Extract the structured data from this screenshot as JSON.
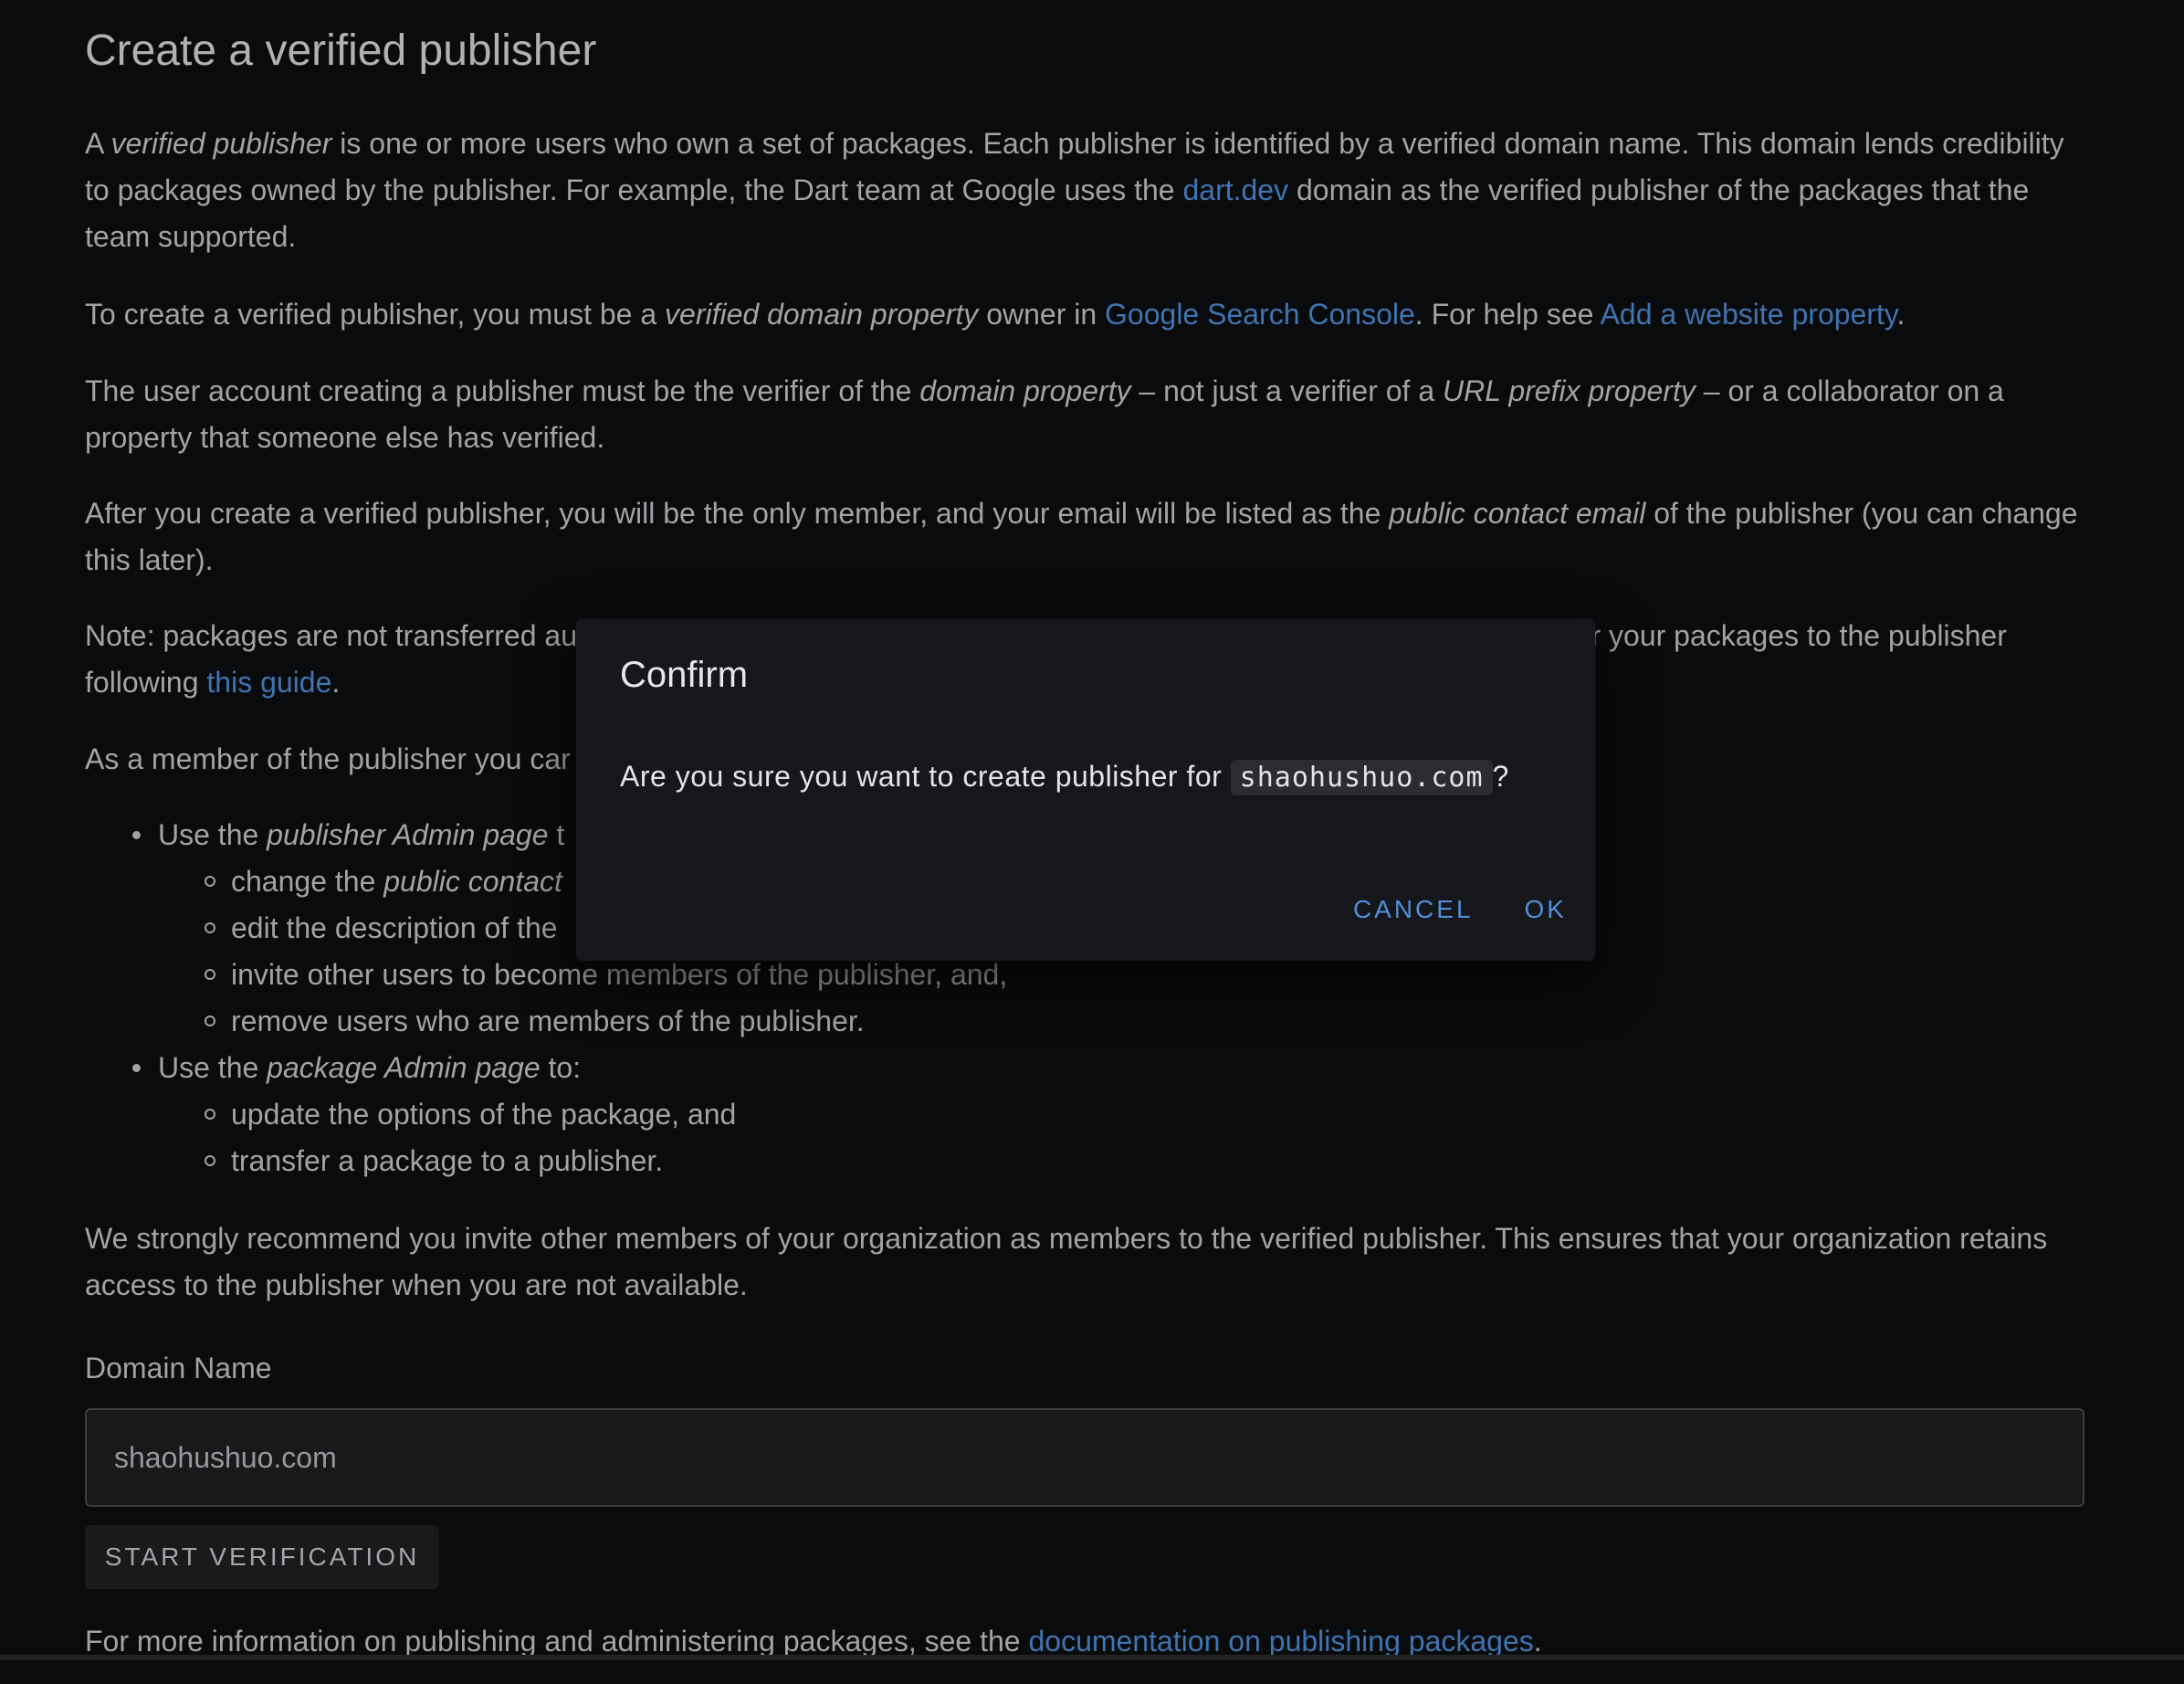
{
  "page": {
    "title": "Create a verified publisher",
    "p1": {
      "t1": "A ",
      "em1": "verified publisher",
      "t2": " is one or more users who own a set of packages. Each publisher is identified by a verified domain name. This domain lends credibility to packages owned by the publisher. For example, the Dart team at Google uses the ",
      "link": "dart.dev",
      "t3": " domain as the verified publisher of the packages that the team supported."
    },
    "p2": {
      "t1": "To create a verified publisher, you must be a ",
      "em1": "verified domain property",
      "t2": " owner in ",
      "link1": "Google Search Console",
      "t3": ". For help see ",
      "link2": "Add a website property",
      "t4": "."
    },
    "p3": {
      "t1": "The user account creating a publisher must be the verifier of the ",
      "em1": "domain property",
      "t2": " – not just a verifier of a ",
      "em2": "URL prefix property",
      "t3": " – or a collaborator on a property that someone else has verified."
    },
    "p4": {
      "t1": "After you create a verified publisher, you will be the only member, and your email will be listed as the ",
      "em1": "public contact email",
      "t2": " of the publisher (you can change this later)."
    },
    "p5": {
      "t1": "Note: packages are not transferred au",
      "t2": "nsfer your packages to the publisher",
      "t3": "following ",
      "link": "this guide",
      "t4": "."
    },
    "p6": {
      "t1": "As a member of the publisher you car"
    },
    "bullets": {
      "b1_t1": "Use the ",
      "b1_em": "publisher Admin page",
      "b1_t2": " t",
      "b1_s1_t1": "change the ",
      "b1_s1_em": "public contact",
      "b1_s2": "edit the description of the",
      "b1_s3a": "invite other users to become",
      "b1_s3b": " members of the publisher, and,",
      "b1_s4": "remove users who are members of the publisher.",
      "b2_t1": "Use the ",
      "b2_em": "package Admin page",
      "b2_t2": " to:",
      "b2_s1": "update the options of the package, and",
      "b2_s2": "transfer a package to a publisher."
    },
    "p7": "We strongly recommend you invite other members of your organization as members to the verified publisher. This ensures that your organization retains access to the publisher when you are not available.",
    "domain_label": "Domain Name",
    "domain_value": "shaohushuo.com",
    "verify_button": "START VERIFICATION",
    "p8": {
      "t1": "For more information on publishing and administering packages, see the ",
      "link": "documentation on publishing packages",
      "t2": "."
    }
  },
  "dialog": {
    "title": "Confirm",
    "msg_prefix": "Are you sure you want to create publisher for ",
    "msg_code": "shaohushuo.com",
    "msg_suffix": "?",
    "cancel": "CANCEL",
    "ok": "OK"
  },
  "colors": {
    "background": "#0d0e10",
    "text": "#c6c7ca",
    "link": "#4c8fd8",
    "dialog_bg": "#16171a",
    "dialog_button": "#4f8fdb"
  }
}
